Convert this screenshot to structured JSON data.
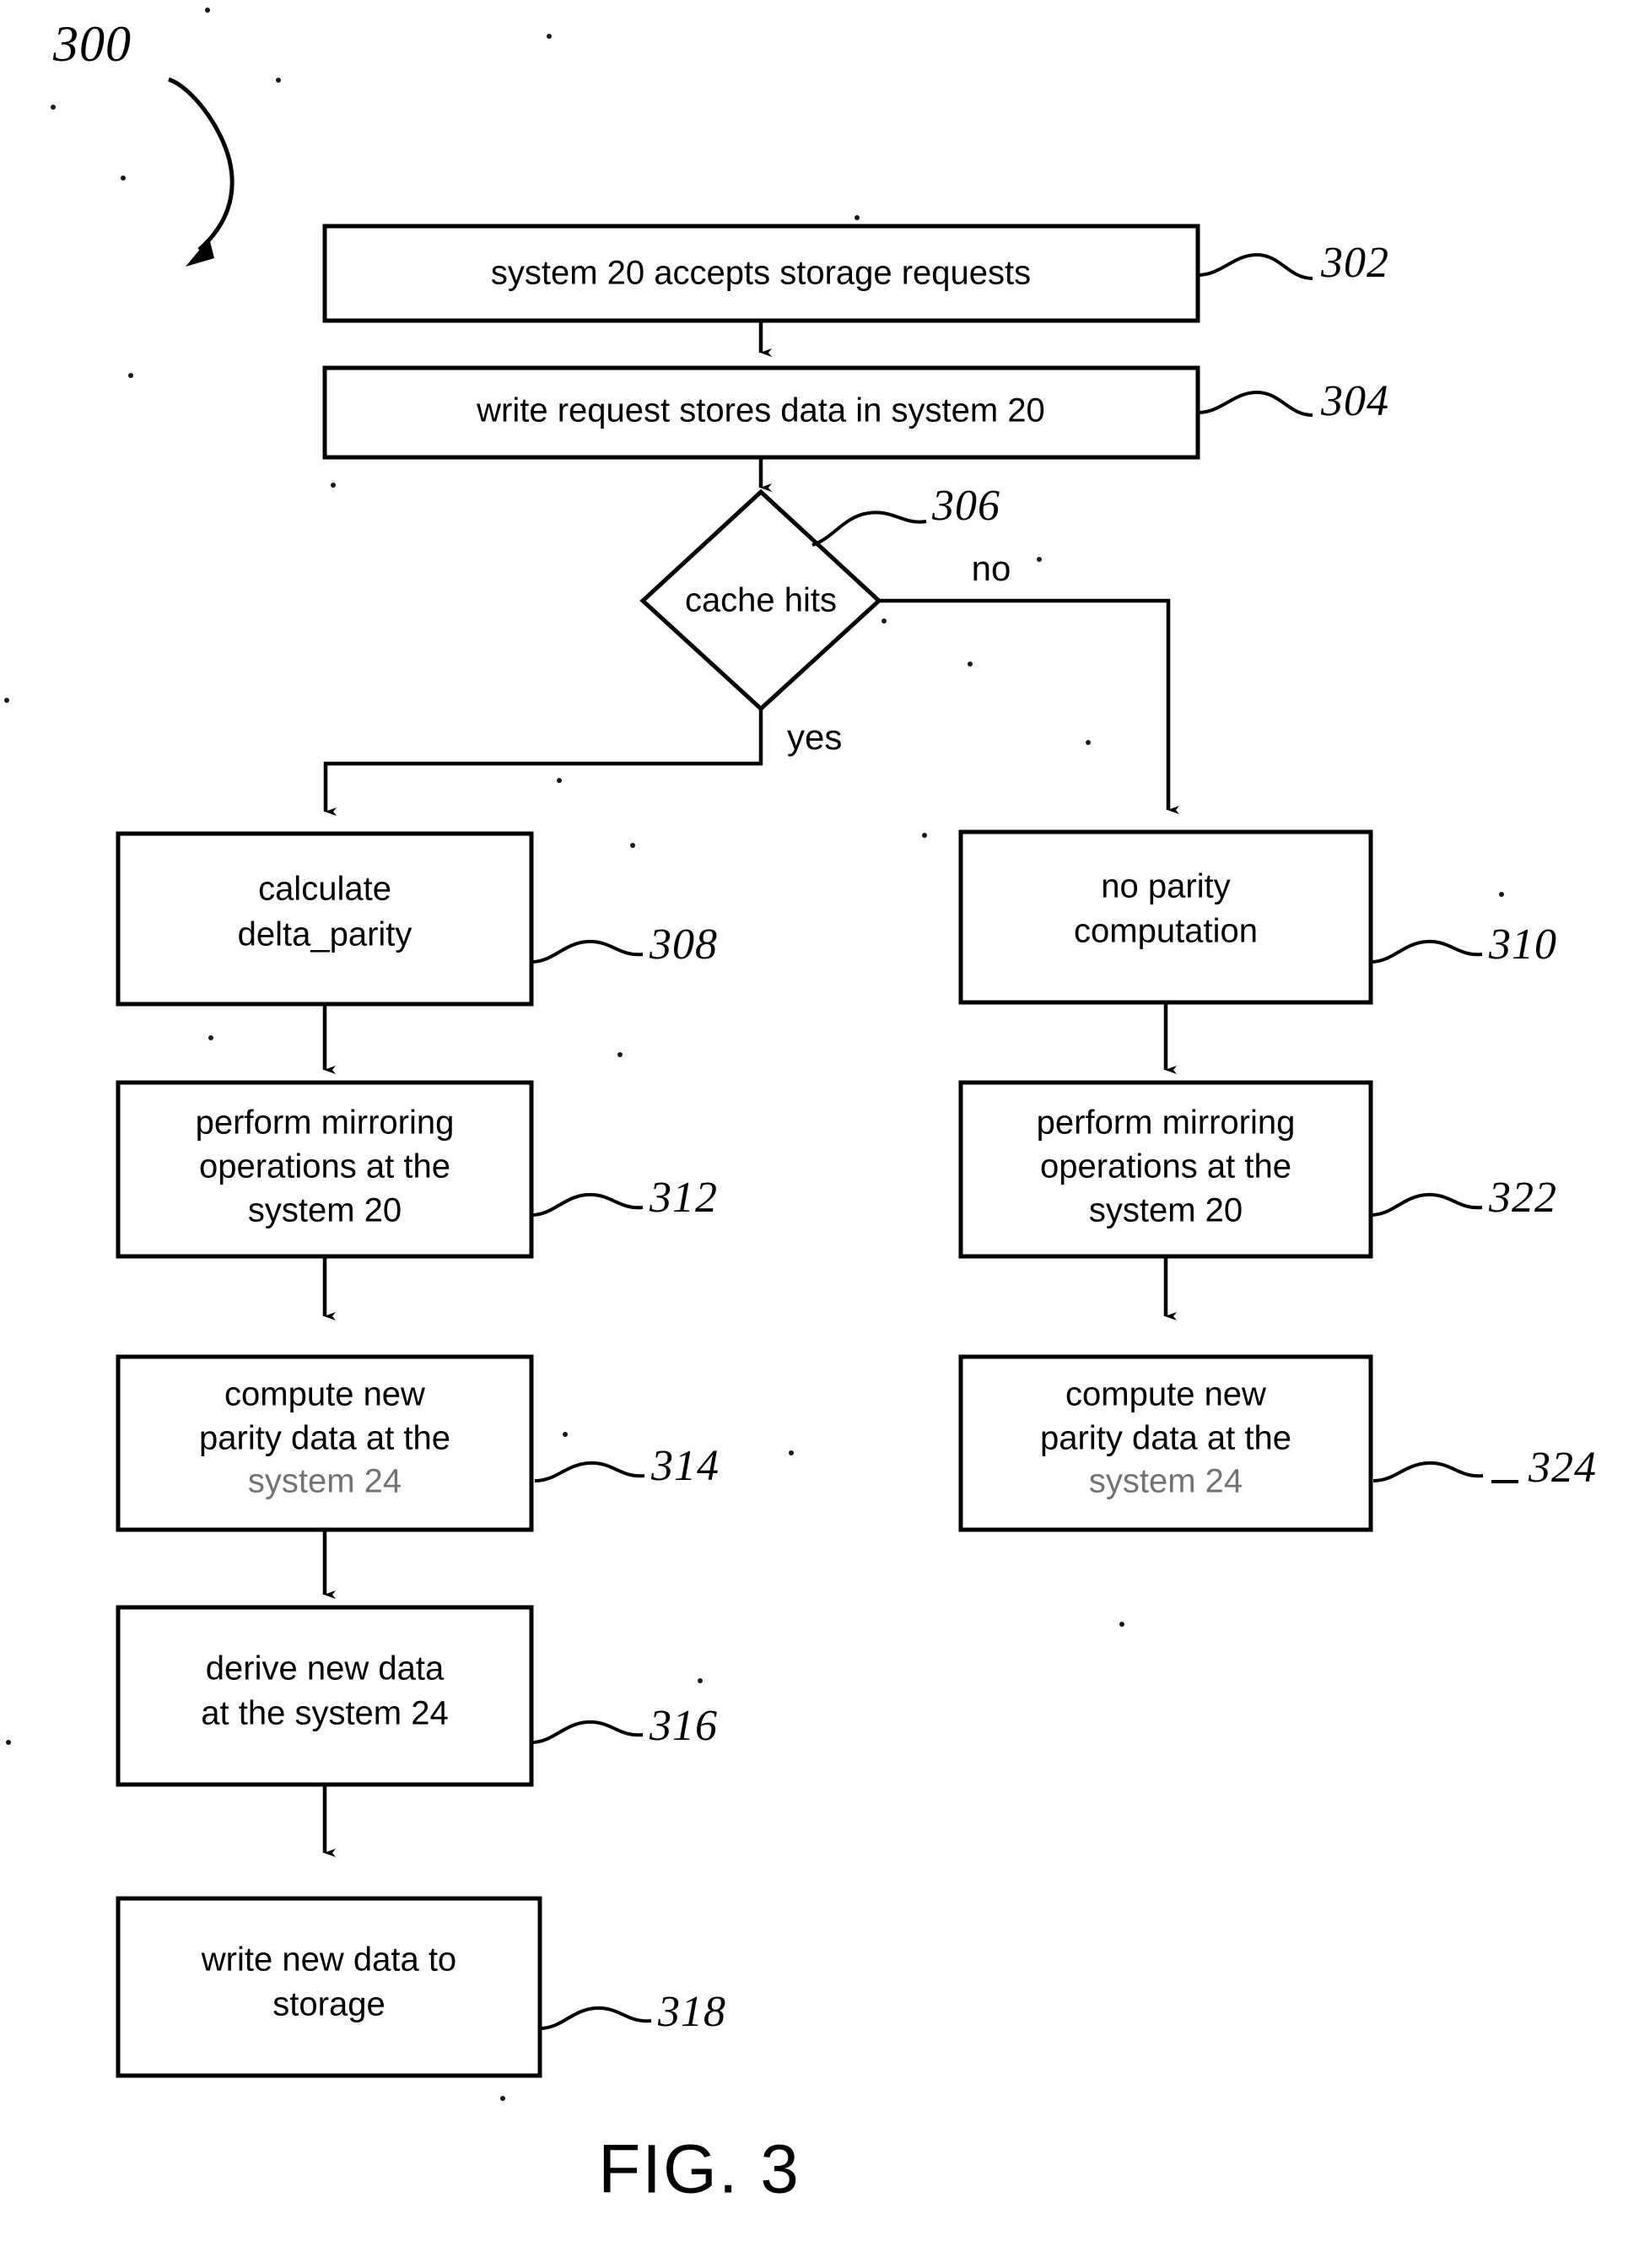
{
  "figure": {
    "caption": "FIG. 3",
    "diagram_ref": "300",
    "type": "flowchart"
  },
  "boxes": [
    {
      "ref": "302",
      "lines": [
        "system 20 accepts storage requests"
      ],
      "name": "process-box-302"
    },
    {
      "ref": "304",
      "lines": [
        "write request stores data in system 20"
      ],
      "name": "process-box-304"
    },
    {
      "ref": "308",
      "lines": [
        "calculate",
        "delta_parity"
      ],
      "name": "process-box-308"
    },
    {
      "ref": "312",
      "lines": [
        "perform mirroring",
        "operations at the",
        "system 20"
      ],
      "name": "process-box-312"
    },
    {
      "ref": "314",
      "lines": [
        "compute new",
        "parity data at the",
        "system 24"
      ],
      "name": "process-box-314"
    },
    {
      "ref": "316",
      "lines": [
        "derive new data",
        "at the system 24"
      ],
      "name": "process-box-316"
    },
    {
      "ref": "318",
      "lines": [
        "write new data to",
        "storage"
      ],
      "name": "process-box-318"
    },
    {
      "ref": "310",
      "lines": [
        "no parity",
        "computation"
      ],
      "name": "process-box-310"
    },
    {
      "ref": "322",
      "lines": [
        "perform mirroring",
        "operations at the",
        "system 20"
      ],
      "name": "process-box-322"
    },
    {
      "ref": "324",
      "lines": [
        "compute new",
        "parity data at the",
        "system 24"
      ],
      "name": "process-box-324"
    }
  ],
  "decision": {
    "ref": "306",
    "label": "cache hits",
    "branch_yes": "yes",
    "branch_no": "no"
  },
  "colors": {
    "stroke": "#000000",
    "background": "#ffffff"
  }
}
